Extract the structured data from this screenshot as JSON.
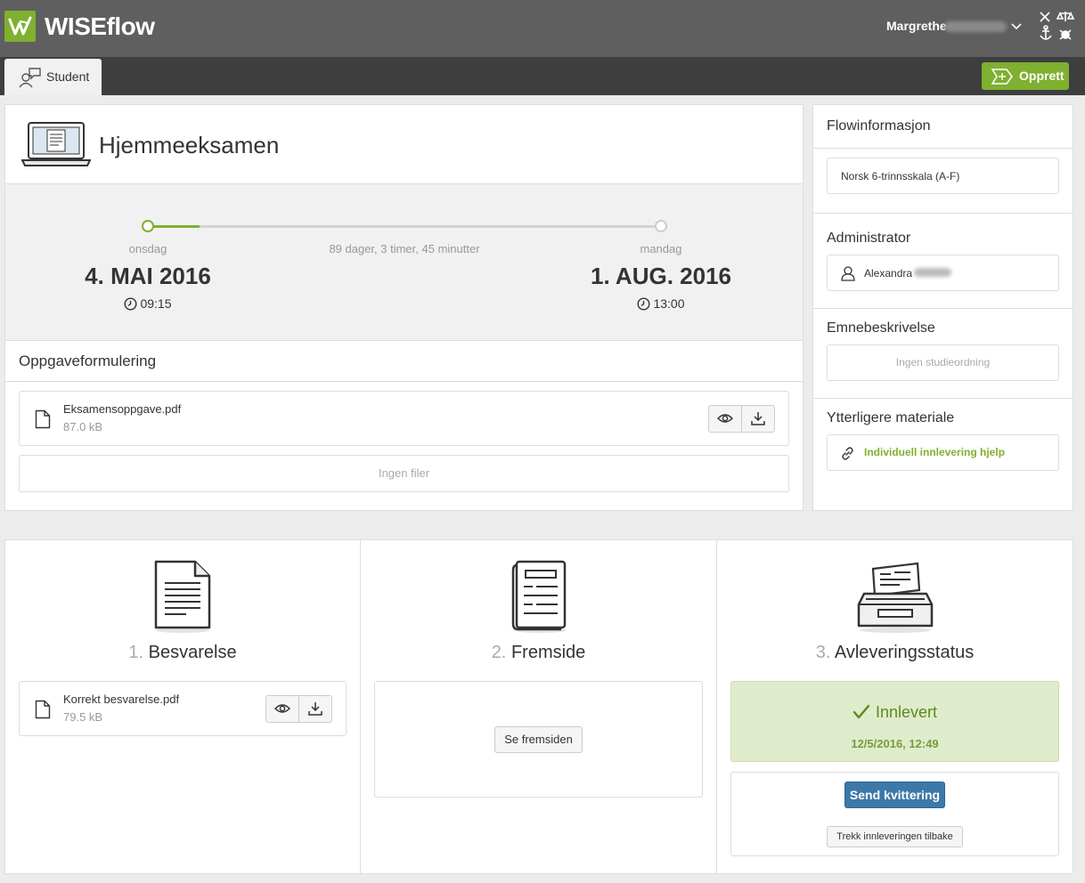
{
  "header": {
    "brand": "WISEflow",
    "user_name": "Margrethe",
    "colors": {
      "topbar": "#5f5f5f",
      "accent": "#7fb02f"
    }
  },
  "tabs": {
    "student": "Student",
    "create_button": "Opprett"
  },
  "exam": {
    "title": "Hjemmeeksamen",
    "start": {
      "weekday": "onsdag",
      "date": "4. MAI 2016",
      "time": "09:15"
    },
    "end": {
      "weekday": "mandag",
      "date": "1. AUG. 2016",
      "time": "13:00"
    },
    "duration": "89 dager, 3 timer, 45 minutter",
    "assignment_heading": "Oppgaveformulering",
    "assignment_file": {
      "name": "Eksamensoppgave.pdf",
      "size": "87.0 kB"
    },
    "no_files": "Ingen filer"
  },
  "sidebar": {
    "title": "Flowinformasjon",
    "grading_scale": "Norsk 6-trinnsskala (A-F)",
    "administrator_heading": "Administrator",
    "administrator_name": "Alexandra",
    "subject_heading": "Emnebeskrivelse",
    "subject_value": "Ingen studieordning",
    "material_heading": "Ytterligere materiale",
    "material_link": "Individuell innlevering hjelp"
  },
  "steps": {
    "answer": {
      "num": "1.",
      "title": "Besvarelse",
      "file_name": "Korrekt besvarelse.pdf",
      "file_size": "79.5 kB"
    },
    "frontpage": {
      "num": "2.",
      "title": "Fremside",
      "button": "Se fremsiden"
    },
    "status": {
      "num": "3.",
      "title": "Avleveringsstatus",
      "state": "Innlevert",
      "timestamp": "12/5/2016, 12:49",
      "send_receipt": "Send kvittering",
      "withdraw": "Trekk innleveringen tilbake"
    }
  }
}
